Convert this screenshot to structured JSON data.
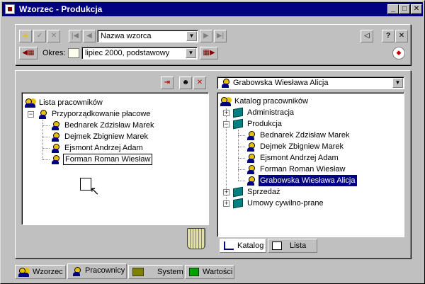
{
  "window": {
    "title": "Wzorzec - Produkcja"
  },
  "toolbar": {
    "nav_combo": "Nazwa wzorca",
    "period_label": "Okres:",
    "period_combo": "lipiec 2000, podstawowy",
    "help_label": "?"
  },
  "left_tree": {
    "root": "Lista pracowników",
    "group": "Przyporządkowanie płacowe",
    "items": [
      "Bednarek Zdzisław Marek",
      "Dejmek Zbigniew Marek",
      "Ejsmont Andrzej Adam",
      "Forman Roman Wiesław"
    ]
  },
  "right_panel": {
    "employee_combo": "Grabowska Wiesława Alicja",
    "root": "Katalog pracowników",
    "nodes": [
      "Administracja",
      "Produkcja",
      "Sprzedaż",
      "Umowy cywilno-prane"
    ],
    "produkcja_items": [
      "Bednarek Zdzisław Marek",
      "Dejmek Zbigniew Marek",
      "Ejsmont Andrzej Adam",
      "Forman Roman Wiesław",
      "Grabowska Wiesława Alicja"
    ],
    "tabs": [
      "Katalog",
      "Lista"
    ]
  },
  "bottom_tabs": [
    "Wzorzec",
    "Pracownicy",
    "System",
    "Wartości"
  ],
  "colors": {
    "title_bar": "#000080",
    "selection": "#000080",
    "face": "#c0c0c0"
  }
}
